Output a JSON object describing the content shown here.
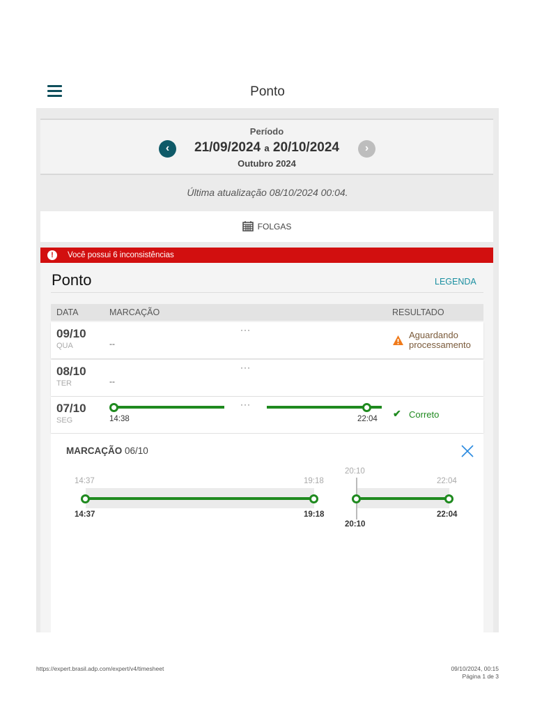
{
  "header": {
    "title": "Ponto"
  },
  "period": {
    "label": "Período",
    "start": "21/09/2024",
    "connector": "a",
    "end": "20/10/2024",
    "month": "Outubro 2024"
  },
  "last_update": "Última atualização 08/10/2024 00:04.",
  "folgas_label": "FOLGAS",
  "alert": {
    "text": "Você possui 6 inconsistências",
    "color": "#d20f0f"
  },
  "section": {
    "title": "Ponto",
    "legend_link": "LEGENDA"
  },
  "table": {
    "headers": [
      "DATA",
      "MARCAÇÃO",
      "RESULTADO"
    ],
    "rows": [
      {
        "date": "09/10",
        "weekday": "QUA",
        "marks": "--",
        "dots": "···",
        "result": "Aguardando processamento",
        "result_line1": "Aguardando",
        "result_line2": "processamento"
      },
      {
        "date": "08/10",
        "weekday": "TER",
        "marks": "--",
        "dots": "···"
      },
      {
        "date": "07/10",
        "weekday": "SEG",
        "start": "14:38",
        "end": "22:04",
        "dots": "···",
        "result": "Correto"
      }
    ]
  },
  "detail": {
    "title": "MARCAÇÃO",
    "date": "06/10",
    "segments": [
      {
        "expected_start": "14:37",
        "expected_end": "19:18",
        "actual_start": "14:37",
        "actual_end": "19:18"
      },
      {
        "expected_start": "20:10",
        "expected_end": "22:04",
        "actual_start": "20:10",
        "actual_end": "22:04"
      }
    ]
  },
  "footer": {
    "url": "https://expert.brasil.adp.com/expert/v4/timesheet",
    "datetime": "09/10/2024, 00:15",
    "page": "Página 1 de 3"
  },
  "colors": {
    "accent": "#0f4f5c",
    "green": "#1f8a1f",
    "warning": "#f07a1a",
    "link": "#1a8fa0"
  }
}
